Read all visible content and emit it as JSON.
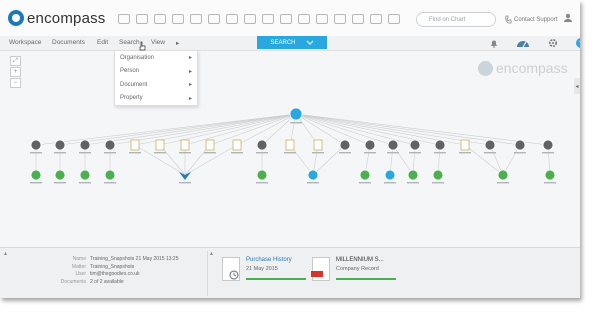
{
  "app": {
    "logo_text": "encompass",
    "watermark_text": "encompass"
  },
  "header": {
    "find_placeholder": "Find on Chart",
    "contact_label": "Contact Support"
  },
  "menu": {
    "items": [
      "Workspace",
      "Documents",
      "Edit",
      "Search",
      "View"
    ],
    "search_label": "SEARCH"
  },
  "search_dropdown": {
    "items": [
      "Organisation",
      "Person",
      "Document",
      "Property"
    ]
  },
  "details": {
    "rows": [
      {
        "key": "Name",
        "value": "Training_Snapshots 21 May 2015 13:25"
      },
      {
        "key": "Matter",
        "value": "Training_Snapshots"
      },
      {
        "key": "User",
        "value": "tim@thegoodies.co.uk"
      },
      {
        "key": "Documents",
        "value": "2 of 2 available"
      }
    ]
  },
  "documents": [
    {
      "title": "Purchase History",
      "subtitle": "21 May 2015",
      "progress": 1.0
    },
    {
      "title": "MILLENNIUM S...",
      "subtitle": "Company Record",
      "progress": 1.0
    }
  ],
  "colors": {
    "accent": "#29a8e0",
    "person_node": "#5f6366",
    "location_node": "#4caf50",
    "root_node": "#29a8e0",
    "link": "#c9cdd0"
  }
}
